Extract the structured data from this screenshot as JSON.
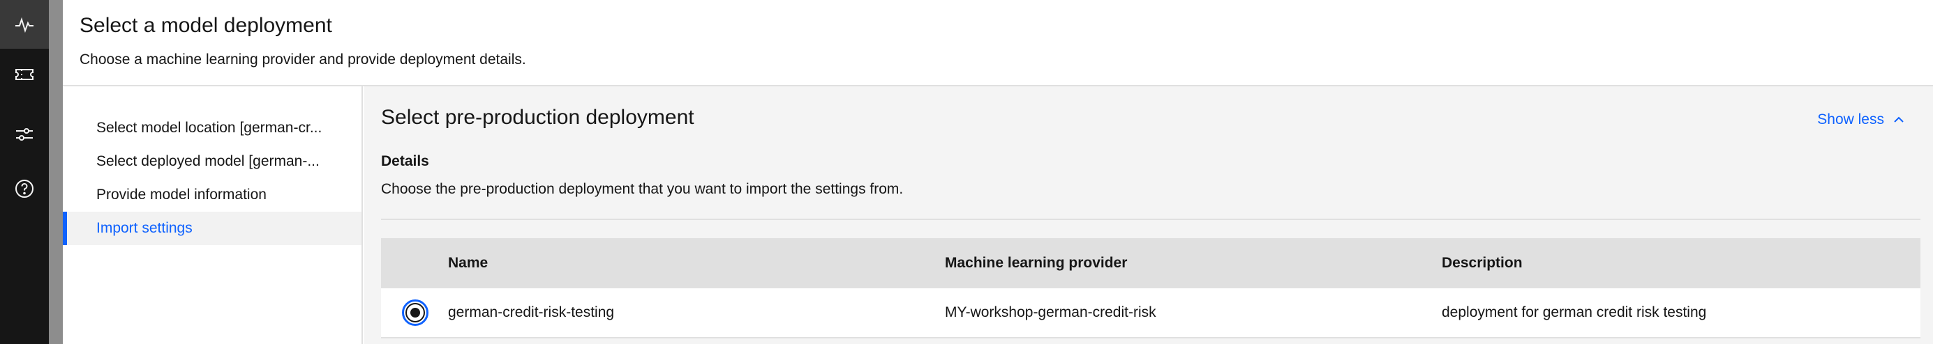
{
  "rail": {
    "items": [
      {
        "icon": "activity-icon",
        "active": true
      },
      {
        "icon": "ticket-icon",
        "active": false
      },
      {
        "icon": "settings-adjust-icon",
        "active": false
      },
      {
        "icon": "help-icon",
        "active": false
      }
    ]
  },
  "header": {
    "title": "Select a model deployment",
    "subtitle": "Choose a machine learning provider and provide deployment details."
  },
  "steps": [
    {
      "label": "Select model location [german-cr...",
      "current": false
    },
    {
      "label": "Select deployed model [german-...",
      "current": false
    },
    {
      "label": "Provide model information",
      "current": false
    },
    {
      "label": "Import settings",
      "current": true
    }
  ],
  "main": {
    "title": "Select pre-production deployment",
    "show_less_label": "Show less",
    "details_label": "Details",
    "details_description": "Choose the pre-production deployment that you want to import the settings from."
  },
  "table": {
    "headers": {
      "name": "Name",
      "provider": "Machine learning provider",
      "description": "Description"
    },
    "rows": [
      {
        "selected": true,
        "name": "german-credit-risk-testing",
        "provider": "MY-workshop-german-credit-risk",
        "description": "deployment for german credit risk testing"
      }
    ]
  },
  "colors": {
    "accent": "#0f62fe",
    "rail_bg": "#161616",
    "rail_active": "#393939",
    "panel_bg": "#f4f4f4",
    "table_header_bg": "#e0e0e0"
  }
}
